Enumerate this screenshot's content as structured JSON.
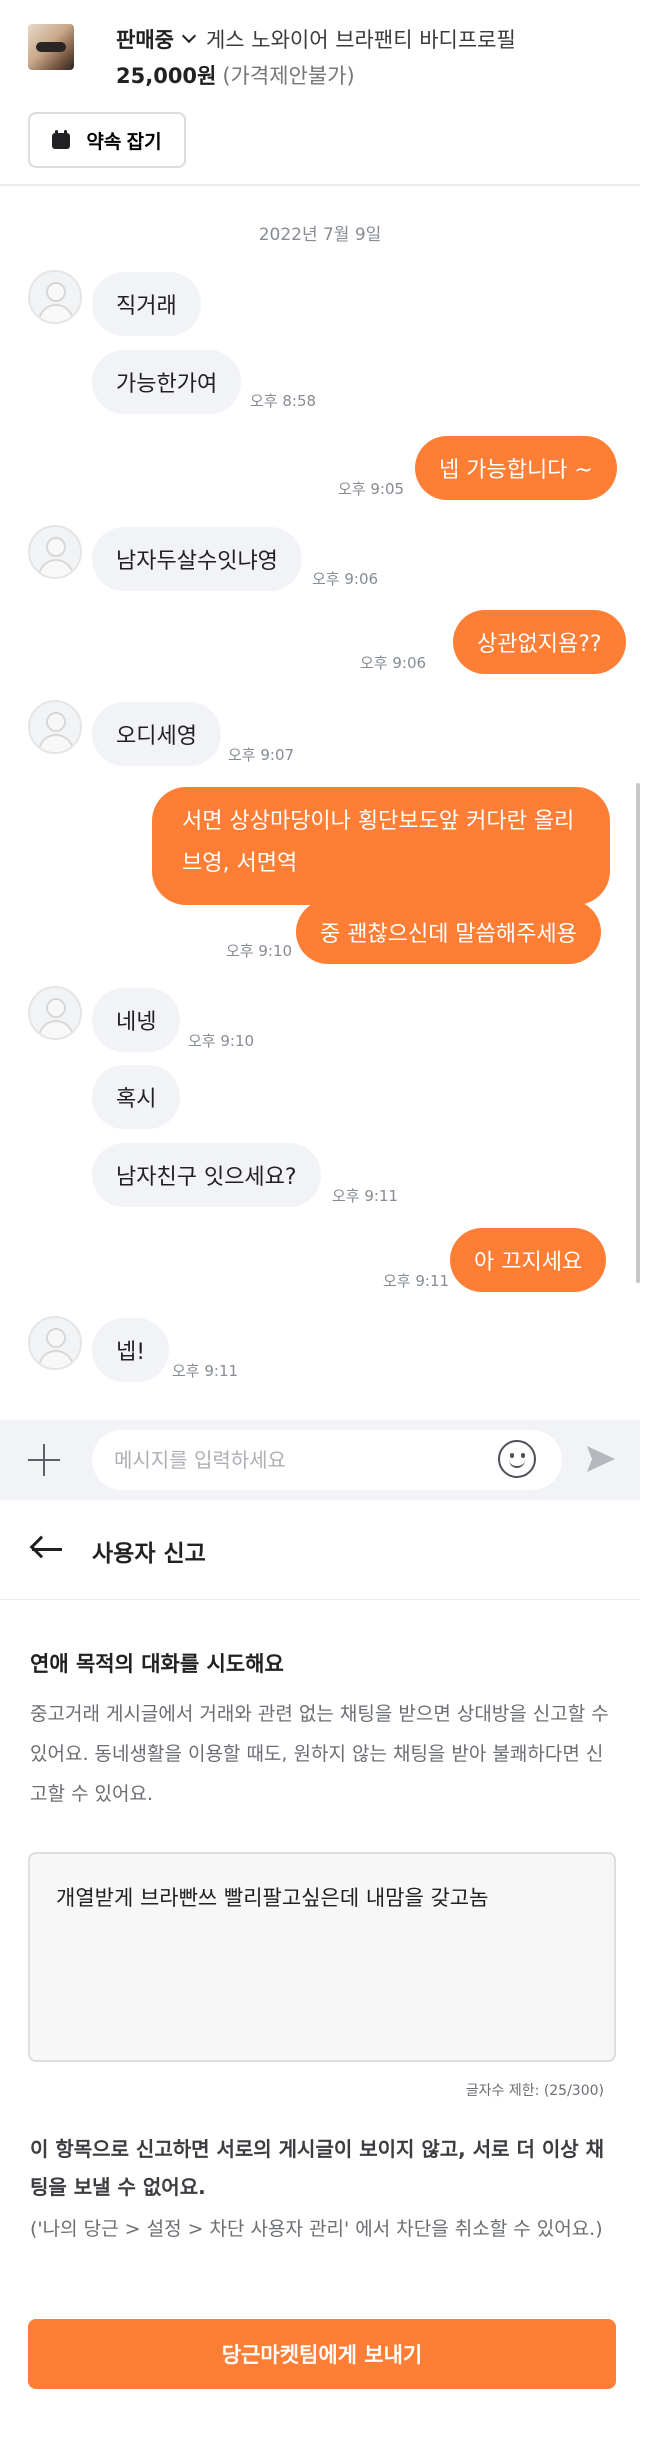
{
  "product": {
    "status": "판매중",
    "title": "게스 노와이어 브라팬티 바디프로필",
    "price": "25,000원",
    "negotiation": "(가격제안불가)",
    "appointment_button": "약속 잡기"
  },
  "chat": {
    "date": "2022년 7월 9일",
    "messages": [
      {
        "side": "in",
        "text": "직거래",
        "time": ""
      },
      {
        "side": "in",
        "text": "가능한가여",
        "time": "오후 8:58"
      },
      {
        "side": "out",
        "text": "넵 가능합니다 ~",
        "time": "오후 9:05"
      },
      {
        "side": "in",
        "text": "남자두살수잇냐영",
        "time": "오후 9:06"
      },
      {
        "side": "out",
        "text": "상관없지욤??",
        "time": "오후 9:06"
      },
      {
        "side": "in",
        "text": "오디세영",
        "time": "오후 9:07"
      },
      {
        "side": "out",
        "text": "서면 상상마당이나 횡단보도앞 커다란 올리브영, 서면역",
        "time": ""
      },
      {
        "side": "out",
        "text": "중 괜찮으신데 말씀해주세용",
        "time": "오후 9:10"
      },
      {
        "side": "in",
        "text": "네넹",
        "time": "오후 9:10"
      },
      {
        "side": "in",
        "text": "혹시",
        "time": ""
      },
      {
        "side": "in",
        "text": "남자친구 잇으세요?",
        "time": "오후 9:11"
      },
      {
        "side": "out",
        "text": "아 끄지세요",
        "time": "오후 9:11"
      },
      {
        "side": "in",
        "text": "넵!",
        "time": "오후 9:11"
      }
    ]
  },
  "input": {
    "placeholder": "메시지를 입력하세요",
    "plus_icon": "plus-icon",
    "emoji_icon": "emoji-icon",
    "send_icon": "send-icon"
  },
  "report": {
    "header_title": "사용자 신고",
    "reason_title": "연애 목적의 대화를 시도해요",
    "reason_description": "중고거래 게시글에서 거래와 관련 없는 채팅을 받으면 상대방을 신고할 수 있어요. 동네생활을 이용할 때도, 원하지 않는 채팅을 받아 불쾌하다면 신고할 수 있어요.",
    "text_value": "개열받게 브라빤쓰 빨리팔고싶은데 내맘을 갖고놈",
    "char_count": "글자수 제한: (25/300)",
    "warning": "이 항목으로 신고하면 서로의 게시글이 보이지 않고, 서로 더 이상 채팅을 보낼 수 없어요.",
    "hint": "('나의 당근 > 설정 > 차단 사용자 관리' 에서 차단을 취소할 수 있어요.)",
    "submit_button": "당근마켓팀에게 보내기"
  },
  "colors": {
    "accent": "#ff7e36",
    "incoming_bubble": "#f2f3f6",
    "time_text": "#868b94"
  }
}
